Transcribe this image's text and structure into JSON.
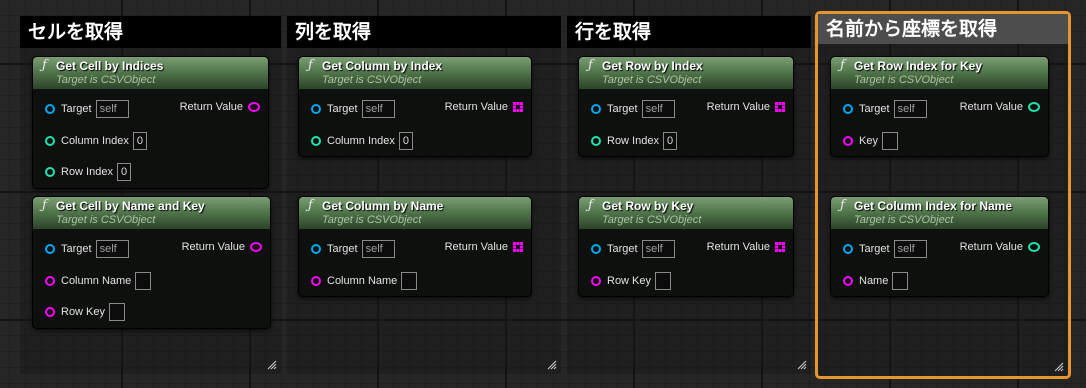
{
  "colors": {
    "accent_selected": "#e6962a",
    "node_header": "#557a4f",
    "pin_object": "#00a8f3",
    "pin_integer": "#1fe3af",
    "pin_string": "#fb03fb"
  },
  "comments": [
    {
      "title": "セルを取得",
      "selected": false
    },
    {
      "title": "列を取得",
      "selected": false
    },
    {
      "title": "行を取得",
      "selected": false
    },
    {
      "title": "名前から座標を取得",
      "selected": true
    }
  ],
  "nodes": {
    "get_cell_by_indices": {
      "icon": "function-icon",
      "title": "Get Cell by Indices",
      "subtitle": "Target is CSVObject",
      "target_label": "Target",
      "target_value": "self",
      "return_label": "Return Value",
      "return_type": "string",
      "param1_label": "Column Index",
      "param1_value": "0",
      "param2_label": "Row Index",
      "param2_value": "0"
    },
    "get_cell_by_name_and_key": {
      "icon": "function-icon",
      "title": "Get Cell by Name and Key",
      "subtitle": "Target is CSVObject",
      "target_label": "Target",
      "target_value": "self",
      "return_label": "Return Value",
      "return_type": "string",
      "param1_label": "Column Name",
      "param1_value": "",
      "param2_label": "Row Key",
      "param2_value": ""
    },
    "get_column_by_index": {
      "icon": "function-icon",
      "title": "Get Column by Index",
      "subtitle": "Target is CSVObject",
      "target_label": "Target",
      "target_value": "self",
      "return_label": "Return Value",
      "return_type": "string-array",
      "param1_label": "Column Index",
      "param1_value": "0"
    },
    "get_column_by_name": {
      "icon": "function-icon",
      "title": "Get Column by Name",
      "subtitle": "Target is CSVObject",
      "target_label": "Target",
      "target_value": "self",
      "return_label": "Return Value",
      "return_type": "string-array",
      "param1_label": "Column Name",
      "param1_value": ""
    },
    "get_row_by_index": {
      "icon": "function-icon",
      "title": "Get Row by Index",
      "subtitle": "Target is CSVObject",
      "target_label": "Target",
      "target_value": "self",
      "return_label": "Return Value",
      "return_type": "string-array",
      "param1_label": "Row Index",
      "param1_value": "0"
    },
    "get_row_by_key": {
      "icon": "function-icon",
      "title": "Get Row by Key",
      "subtitle": "Target is CSVObject",
      "target_label": "Target",
      "target_value": "self",
      "return_label": "Return Value",
      "return_type": "string-array",
      "param1_label": "Row Key",
      "param1_value": ""
    },
    "get_row_index_for_key": {
      "icon": "function-icon",
      "title": "Get Row Index for Key",
      "subtitle": "Target is CSVObject",
      "target_label": "Target",
      "target_value": "self",
      "return_label": "Return Value",
      "return_type": "integer",
      "param1_label": "Key",
      "param1_value": ""
    },
    "get_column_index_for_name": {
      "icon": "function-icon",
      "title": "Get Column Index for Name",
      "subtitle": "Target is CSVObject",
      "target_label": "Target",
      "target_value": "self",
      "return_label": "Return Value",
      "return_type": "integer",
      "param1_label": "Name",
      "param1_value": ""
    }
  }
}
